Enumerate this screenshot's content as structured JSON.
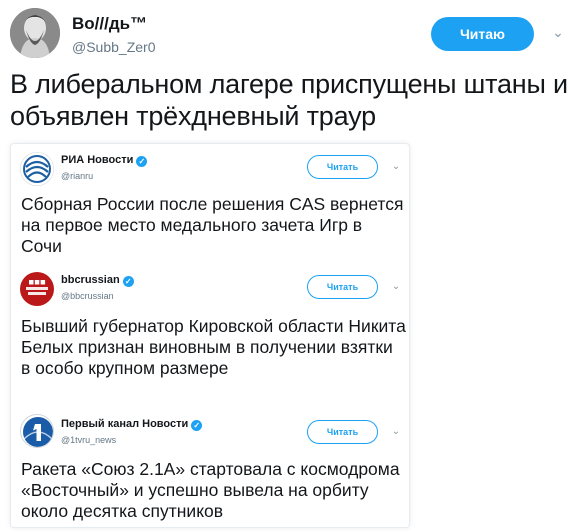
{
  "tweet": {
    "display_name": "Во///дь™",
    "handle": "@Subb_Zer0",
    "follow_label": "Читаю",
    "text": "В либеральном лагере приспущены штаны и объявлен трёхдневный траур"
  },
  "quoted": [
    {
      "name": "РИА Новости",
      "handle": "@rianru",
      "follow_label": "Читать",
      "text": "Сборная России после решения CAS вернется на первое место медального зачета Игр в Сочи"
    },
    {
      "name": "bbcrussian",
      "handle": "@bbcrussian",
      "follow_label": "Читать",
      "logo_text": "BBC РУССКАЯ СЛУЖБА",
      "text": "Бывший губернатор Кировской области Никита Белых признан виновным в получении взятки в особо крупном размере"
    },
    {
      "name": "Первый канал Новости",
      "handle": "@1tvru_news",
      "follow_label": "Читать",
      "text": "Ракета «Союз 2.1А» стартовала с космодрома «Восточный» и успешно вывела на орбиту около десятка спутников"
    }
  ],
  "colors": {
    "accent": "#1da1f2",
    "bbc_red": "#bb1919",
    "ria_blue": "#1d5fa3",
    "channel_one_blue": "#1b5ca8"
  },
  "icons": {
    "verified": "verified-badge-icon",
    "caret": "chevron-down-icon"
  }
}
